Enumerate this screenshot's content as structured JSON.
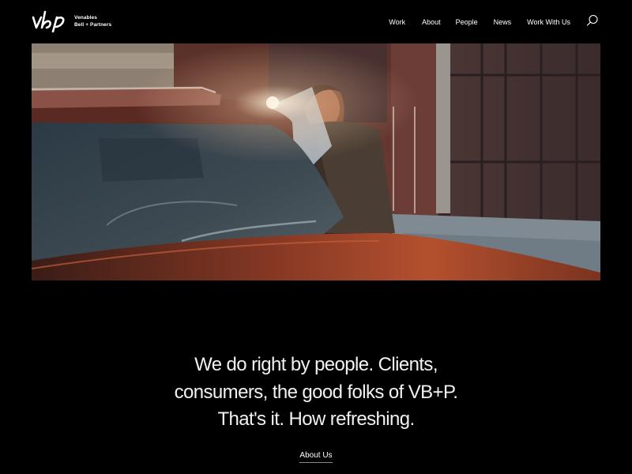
{
  "header": {
    "logo_monogram": "vbp",
    "logo_line1": "Venables",
    "logo_line2": "Bell + Partners",
    "nav": [
      {
        "label": "Work"
      },
      {
        "label": "About"
      },
      {
        "label": "People"
      },
      {
        "label": "News"
      },
      {
        "label": "Work With Us"
      }
    ],
    "search_icon": "search-icon"
  },
  "hero": {
    "media": "video-still"
  },
  "main": {
    "tagline": "We do right by people. Clients, consumers, the good folks of VB+P. That's it. How refreshing.",
    "cta_label": "About Us"
  },
  "colors": {
    "background": "#000000",
    "text": "#ffffff"
  }
}
